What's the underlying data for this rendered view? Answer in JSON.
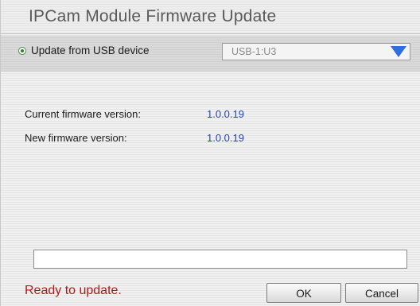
{
  "dialog": {
    "title": "IPCam Module Firmware Update"
  },
  "usb": {
    "option_label": "Update from USB device",
    "selected": true,
    "device_value": "USB-1:U3",
    "dropdown_icon": "triangle-down-icon",
    "dropdown_arrow_color": "#2f6de0"
  },
  "firmware": {
    "current_label": "Current firmware version:",
    "current_value": "1.0.0.19",
    "new_label": "New firmware version:",
    "new_value": "1.0.0.19",
    "value_color": "#2342b8"
  },
  "progress": {
    "fraction": 0
  },
  "status": {
    "text": "Ready to update.",
    "color": "#b01818"
  },
  "buttons": {
    "ok_label": "OK",
    "cancel_label": "Cancel"
  }
}
